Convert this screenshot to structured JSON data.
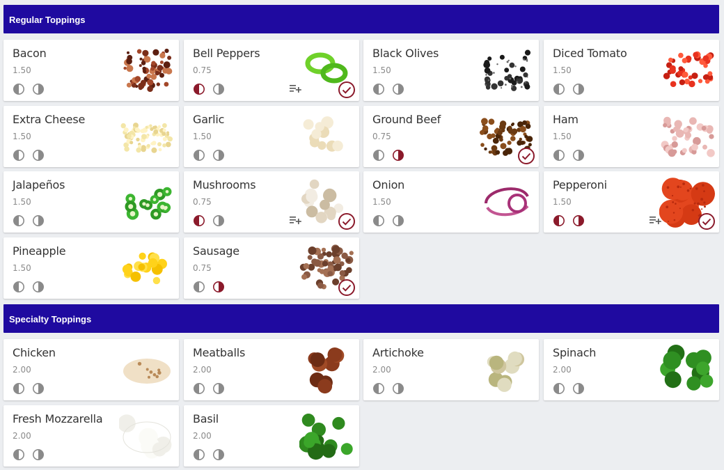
{
  "sections": [
    {
      "title": "Regular Toppings",
      "items": [
        {
          "name": "Bacon",
          "price": "1.50",
          "left_on": false,
          "right_on": false,
          "selected": false,
          "icon": "bacon-image"
        },
        {
          "name": "Bell Peppers",
          "price": "0.75",
          "left_on": true,
          "right_on": false,
          "selected": true,
          "icon": "bell-peppers-image"
        },
        {
          "name": "Black Olives",
          "price": "1.50",
          "left_on": false,
          "right_on": false,
          "selected": false,
          "icon": "black-olives-image"
        },
        {
          "name": "Diced Tomato",
          "price": "1.50",
          "left_on": false,
          "right_on": false,
          "selected": false,
          "icon": "diced-tomato-image"
        },
        {
          "name": "Extra Cheese",
          "price": "1.50",
          "left_on": false,
          "right_on": false,
          "selected": false,
          "icon": "extra-cheese-image"
        },
        {
          "name": "Garlic",
          "price": "1.50",
          "left_on": false,
          "right_on": false,
          "selected": false,
          "icon": "garlic-image"
        },
        {
          "name": "Ground Beef",
          "price": "0.75",
          "left_on": false,
          "right_on": true,
          "selected": true,
          "icon": "ground-beef-image"
        },
        {
          "name": "Ham",
          "price": "1.50",
          "left_on": false,
          "right_on": false,
          "selected": false,
          "icon": "ham-image"
        },
        {
          "name": "Jalapeños",
          "price": "1.50",
          "left_on": false,
          "right_on": false,
          "selected": false,
          "icon": "jalapenos-image"
        },
        {
          "name": "Mushrooms",
          "price": "0.75",
          "left_on": true,
          "right_on": false,
          "selected": true,
          "icon": "mushrooms-image"
        },
        {
          "name": "Onion",
          "price": "1.50",
          "left_on": false,
          "right_on": false,
          "selected": false,
          "icon": "onion-image"
        },
        {
          "name": "Pepperoni",
          "price": "1.50",
          "left_on": true,
          "right_on": true,
          "selected": true,
          "icon": "pepperoni-image"
        },
        {
          "name": "Pineapple",
          "price": "1.50",
          "left_on": false,
          "right_on": false,
          "selected": false,
          "icon": "pineapple-image"
        },
        {
          "name": "Sausage",
          "price": "0.75",
          "left_on": false,
          "right_on": true,
          "selected": true,
          "icon": "sausage-image"
        }
      ]
    },
    {
      "title": "Specialty Toppings",
      "items": [
        {
          "name": "Chicken",
          "price": "2.00",
          "left_on": false,
          "right_on": false,
          "selected": false,
          "icon": "chicken-image"
        },
        {
          "name": "Meatballs",
          "price": "2.00",
          "left_on": false,
          "right_on": false,
          "selected": false,
          "icon": "meatballs-image"
        },
        {
          "name": "Artichoke",
          "price": "2.00",
          "left_on": false,
          "right_on": false,
          "selected": false,
          "icon": "artichoke-image"
        },
        {
          "name": "Spinach",
          "price": "2.00",
          "left_on": false,
          "right_on": false,
          "selected": false,
          "icon": "spinach-image"
        },
        {
          "name": "Fresh Mozzarella",
          "price": "2.00",
          "left_on": false,
          "right_on": false,
          "selected": false,
          "icon": "fresh-mozzarella-image"
        },
        {
          "name": "Basil",
          "price": "2.00",
          "left_on": false,
          "right_on": false,
          "selected": false,
          "icon": "basil-image"
        }
      ]
    }
  ],
  "colors": {
    "header_bg": "#1f0aa0",
    "active_accent": "#8b1a2b",
    "inactive_icon": "#8a8a8a",
    "page_bg": "#eceef1"
  }
}
